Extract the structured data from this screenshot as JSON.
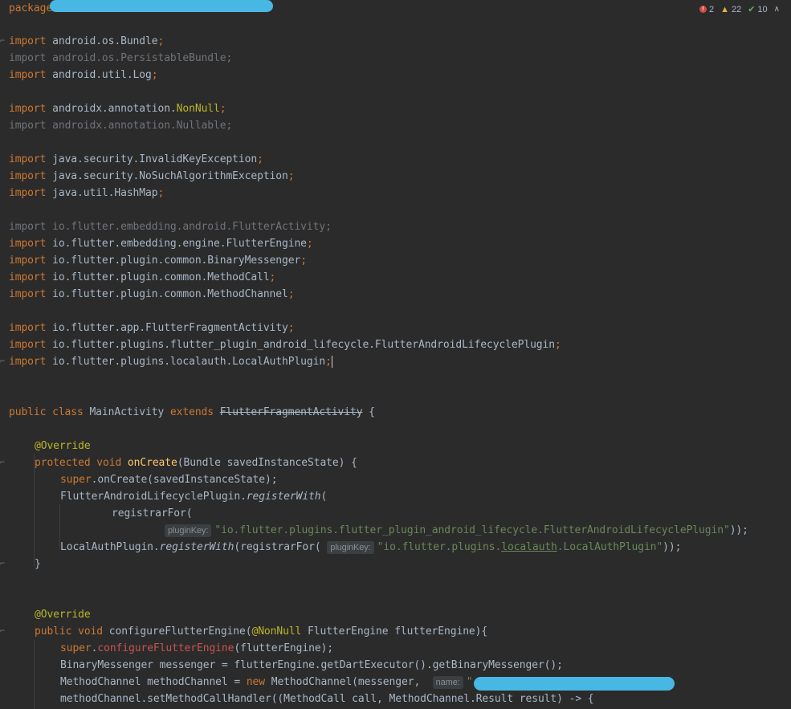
{
  "status": {
    "errors": "2",
    "warnings": "22",
    "weak_warnings": "10"
  },
  "code": {
    "package_kw": "package",
    "imports": [
      "android.os.Bundle",
      "android.os.PersistableBundle",
      "android.util.Log",
      "androidx.annotation.",
      "androidx.annotation.Nullable",
      "java.security.InvalidKeyException",
      "java.security.NoSuchAlgorithmException",
      "java.util.HashMap",
      "io.flutter.embedding.android.FlutterActivity",
      "io.flutter.embedding.engine.FlutterEngine",
      "io.flutter.plugin.common.BinaryMessenger",
      "io.flutter.plugin.common.MethodCall",
      "io.flutter.plugin.common.MethodChannel",
      "io.flutter.app.FlutterFragmentActivity",
      "io.flutter.plugins.flutter_plugin_android_lifecycle.FlutterAndroidLifecyclePlugin",
      "io.flutter.plugins.localauth.LocalAuthPlugin"
    ],
    "import_kw": "import",
    "nonnull_name": "NonNull",
    "class_decl": {
      "public_class": "public class ",
      "name": "MainActivity ",
      "extends": "extends ",
      "parent": "FlutterFragmentActivity",
      "brace": " {"
    },
    "override": "@Override",
    "on_create": {
      "mods": "protected void ",
      "name": "onCreate",
      "params": "(Bundle savedInstanceState) {"
    },
    "super_call": {
      "kw": "super",
      "rest": ".onCreate(savedInstanceState);"
    },
    "register1": {
      "obj": "FlutterAndroidLifecyclePlugin.",
      "method": "registerWith",
      "paren": "("
    },
    "registrar_for": "registrarFor(",
    "hint_plugin_key": "pluginKey:",
    "str_lifecycle": "\"io.flutter.plugins.flutter_plugin_android_lifecycle.FlutterAndroidLifecyclePlugin\"",
    "close1": "));",
    "register2": {
      "obj": "LocalAuthPlugin.",
      "method": "registerWith",
      "mid": "(registrarFor(",
      "str_a": "\"io.flutter.plugins.",
      "str_b": "localauth",
      "str_c": ".LocalAuthPlugin\"",
      "close": "));"
    },
    "close_method": "}",
    "configure": {
      "mods": "public void ",
      "name": "configureFlutterEngine",
      "paren": "(",
      "ann": "@NonNull",
      "params": " FlutterEngine flutterEngine){"
    },
    "super_configure": {
      "kw": "super",
      "dot": ".",
      "name": "configureFlutterEngine",
      "rest": "(flutterEngine);"
    },
    "messenger_line": "BinaryMessenger messenger = flutterEngine.getDartExecutor().getBinaryMessenger();",
    "channel_line": {
      "a": "MethodChannel methodChannel = ",
      "new_kw": "new",
      "b": " MethodChannel(messenger, ",
      "hint": "name:",
      "c": "\""
    },
    "handler_line": "methodChannel.setMethodCallHandler((MethodCall call, MethodChannel.Result result) -> {"
  },
  "colors": {
    "background": "#2b2b2b",
    "keyword": "#cc7832",
    "annotation": "#bbb529",
    "string": "#6a8759",
    "method": "#ffc66d",
    "redaction": "#49b7e3"
  }
}
